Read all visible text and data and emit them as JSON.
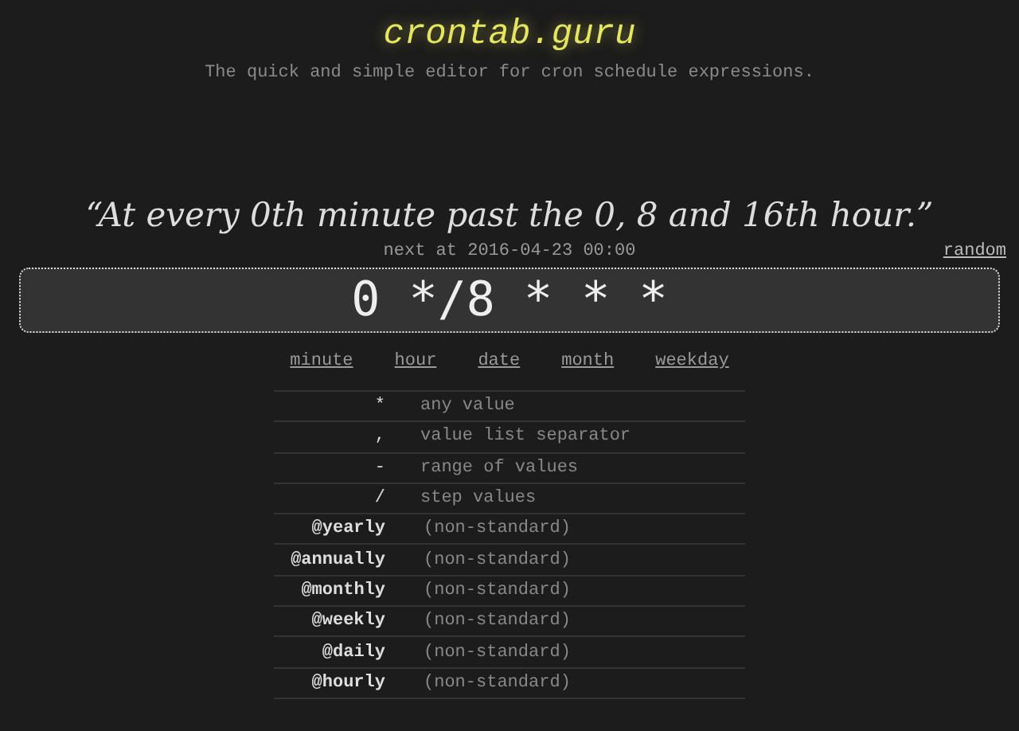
{
  "header": {
    "logo": "crontab.guru",
    "tagline": "The quick and simple editor for cron schedule expressions."
  },
  "description": "“At every 0th minute past the 0, 8 and 16th hour.”",
  "next_run": "next at 2016-04-23 00:00",
  "random_link": "random",
  "expression": "0 */8 * * *",
  "fields": [
    {
      "label": "minute"
    },
    {
      "label": "hour"
    },
    {
      "label": "date"
    },
    {
      "label": "month"
    },
    {
      "label": "weekday"
    }
  ],
  "legend": [
    {
      "kind": "symbol",
      "token": "*",
      "meaning": "any value"
    },
    {
      "kind": "symbol",
      "token": ",",
      "meaning": "value list separator"
    },
    {
      "kind": "symbol",
      "token": "-",
      "meaning": "range of values"
    },
    {
      "kind": "symbol",
      "token": "/",
      "meaning": "step values"
    },
    {
      "kind": "macro",
      "token": "@yearly",
      "meaning": "(non-standard)"
    },
    {
      "kind": "macro",
      "token": "@annually",
      "meaning": "(non-standard)"
    },
    {
      "kind": "macro",
      "token": "@monthly",
      "meaning": "(non-standard)"
    },
    {
      "kind": "macro",
      "token": "@weekly",
      "meaning": "(non-standard)"
    },
    {
      "kind": "macro",
      "token": "@daily",
      "meaning": "(non-standard)"
    },
    {
      "kind": "macro",
      "token": "@hourly",
      "meaning": "(non-standard)"
    }
  ]
}
